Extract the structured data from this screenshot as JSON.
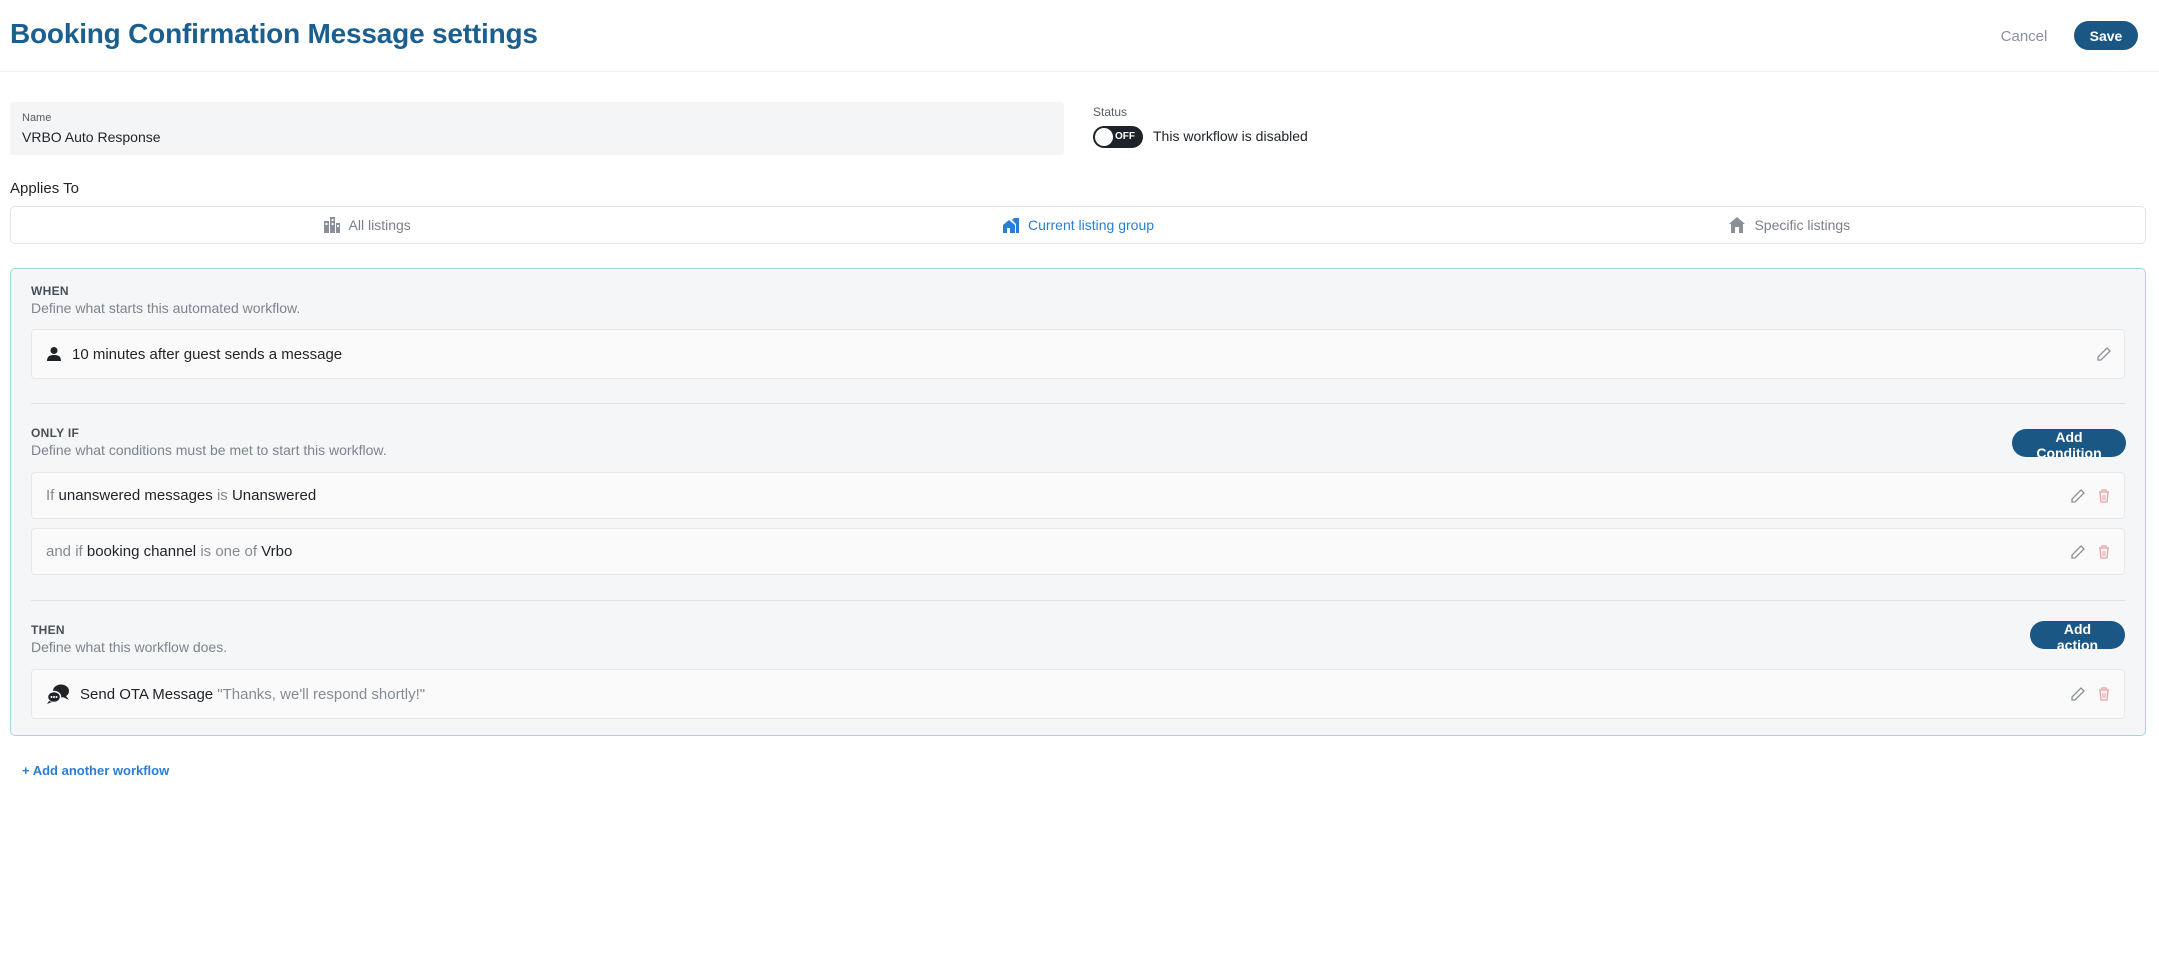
{
  "header": {
    "title": "Booking Confirmation Message settings",
    "cancel_label": "Cancel",
    "save_label": "Save"
  },
  "form": {
    "name_label": "Name",
    "name_value": "VRBO Auto Response",
    "status_label": "Status",
    "toggle_label": "OFF",
    "status_text": "This workflow is disabled"
  },
  "applies_to": {
    "label": "Applies To",
    "options": [
      {
        "label": "All listings",
        "icon": "buildings-icon",
        "active": false
      },
      {
        "label": "Current listing group",
        "icon": "house-group-icon",
        "active": true
      },
      {
        "label": "Specific listings",
        "icon": "house-icon",
        "active": false
      }
    ]
  },
  "when": {
    "title": "WHEN",
    "description": "Define what starts this automated workflow.",
    "trigger": {
      "icon": "person-icon",
      "text": "10 minutes after guest sends a message"
    }
  },
  "only_if": {
    "title": "ONLY IF",
    "description": "Define what conditions must be met to start this workflow.",
    "add_label": "Add Condition",
    "conditions": [
      {
        "prefix": "If",
        "field": "unanswered messages",
        "operator": "is",
        "value": "Unanswered"
      },
      {
        "prefix": "and if",
        "field": "booking channel",
        "operator": "is one of",
        "value": "Vrbo"
      }
    ]
  },
  "then": {
    "title": "THEN",
    "description": "Define what this workflow does.",
    "add_label": "Add action",
    "action": {
      "icon": "chat-bubbles-icon",
      "name": "Send OTA Message",
      "message": "\"Thanks, we'll respond shortly!\""
    }
  },
  "footer": {
    "add_workflow_label": "+ Add another workflow"
  },
  "colors": {
    "title": "#1b5f8f",
    "primary_button": "#1b5785",
    "active_link": "#2d7dd2",
    "delete_icon": "#e8a2a2",
    "workflow_border": "#a9d5de"
  }
}
